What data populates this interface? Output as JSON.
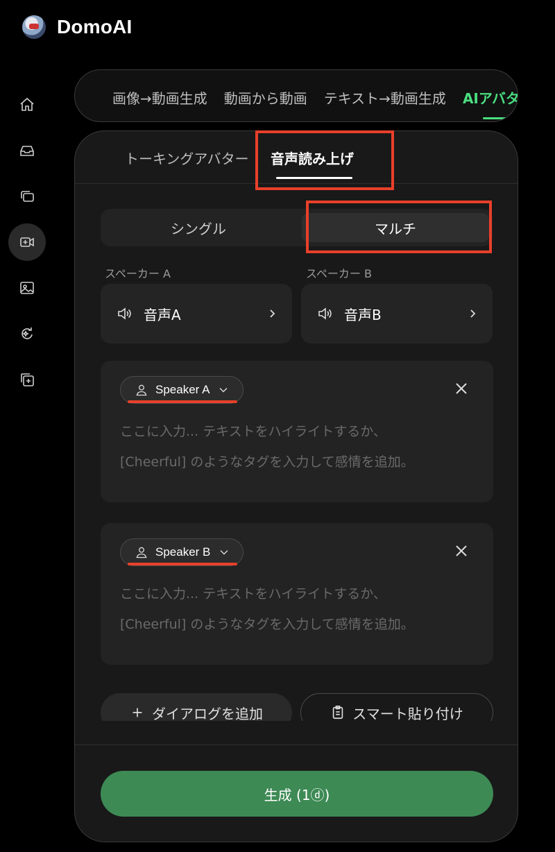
{
  "brand": {
    "name": "DomoAI"
  },
  "sidebar": {
    "items": [
      {
        "icon": "home-icon"
      },
      {
        "icon": "inbox-icon"
      },
      {
        "icon": "layers-icon"
      },
      {
        "icon": "video-add-icon"
      },
      {
        "icon": "image-icon"
      },
      {
        "icon": "refresh-sparkle-icon"
      },
      {
        "icon": "add-square-icon"
      }
    ]
  },
  "top_tabs": [
    {
      "label": "画像→動画生成"
    },
    {
      "label": "動画から動画"
    },
    {
      "label": "テキスト→動画生成"
    },
    {
      "label": "AIアバター"
    }
  ],
  "sub_tabs": {
    "talking_avatar": "トーキングアバター",
    "tts": "音声読み上げ"
  },
  "mode": {
    "single": "シングル",
    "multi": "マルチ"
  },
  "speakers": [
    {
      "label": "スペーカー A",
      "voice": "音声A"
    },
    {
      "label": "スペーカー B",
      "voice": "音声B"
    }
  ],
  "dialogs": [
    {
      "speaker": "Speaker A",
      "placeholder_line1": "ここに入力... テキストをハイライトするか、",
      "placeholder_line2": "[Cheerful] のようなタグを入力して感情を追加。"
    },
    {
      "speaker": "Speaker B",
      "placeholder_line1": "ここに入力... テキストをハイライトするか、",
      "placeholder_line2": "[Cheerful] のようなタグを入力して感情を追加。"
    }
  ],
  "actions": {
    "add_dialog": "ダイアログを追加",
    "smart_paste": "スマート貼り付け"
  },
  "generate": {
    "label": "生成 (1ⓓ)"
  },
  "colors": {
    "accent": "#4ade80",
    "generate": "#3d8a55",
    "highlight": "#e8402a"
  }
}
